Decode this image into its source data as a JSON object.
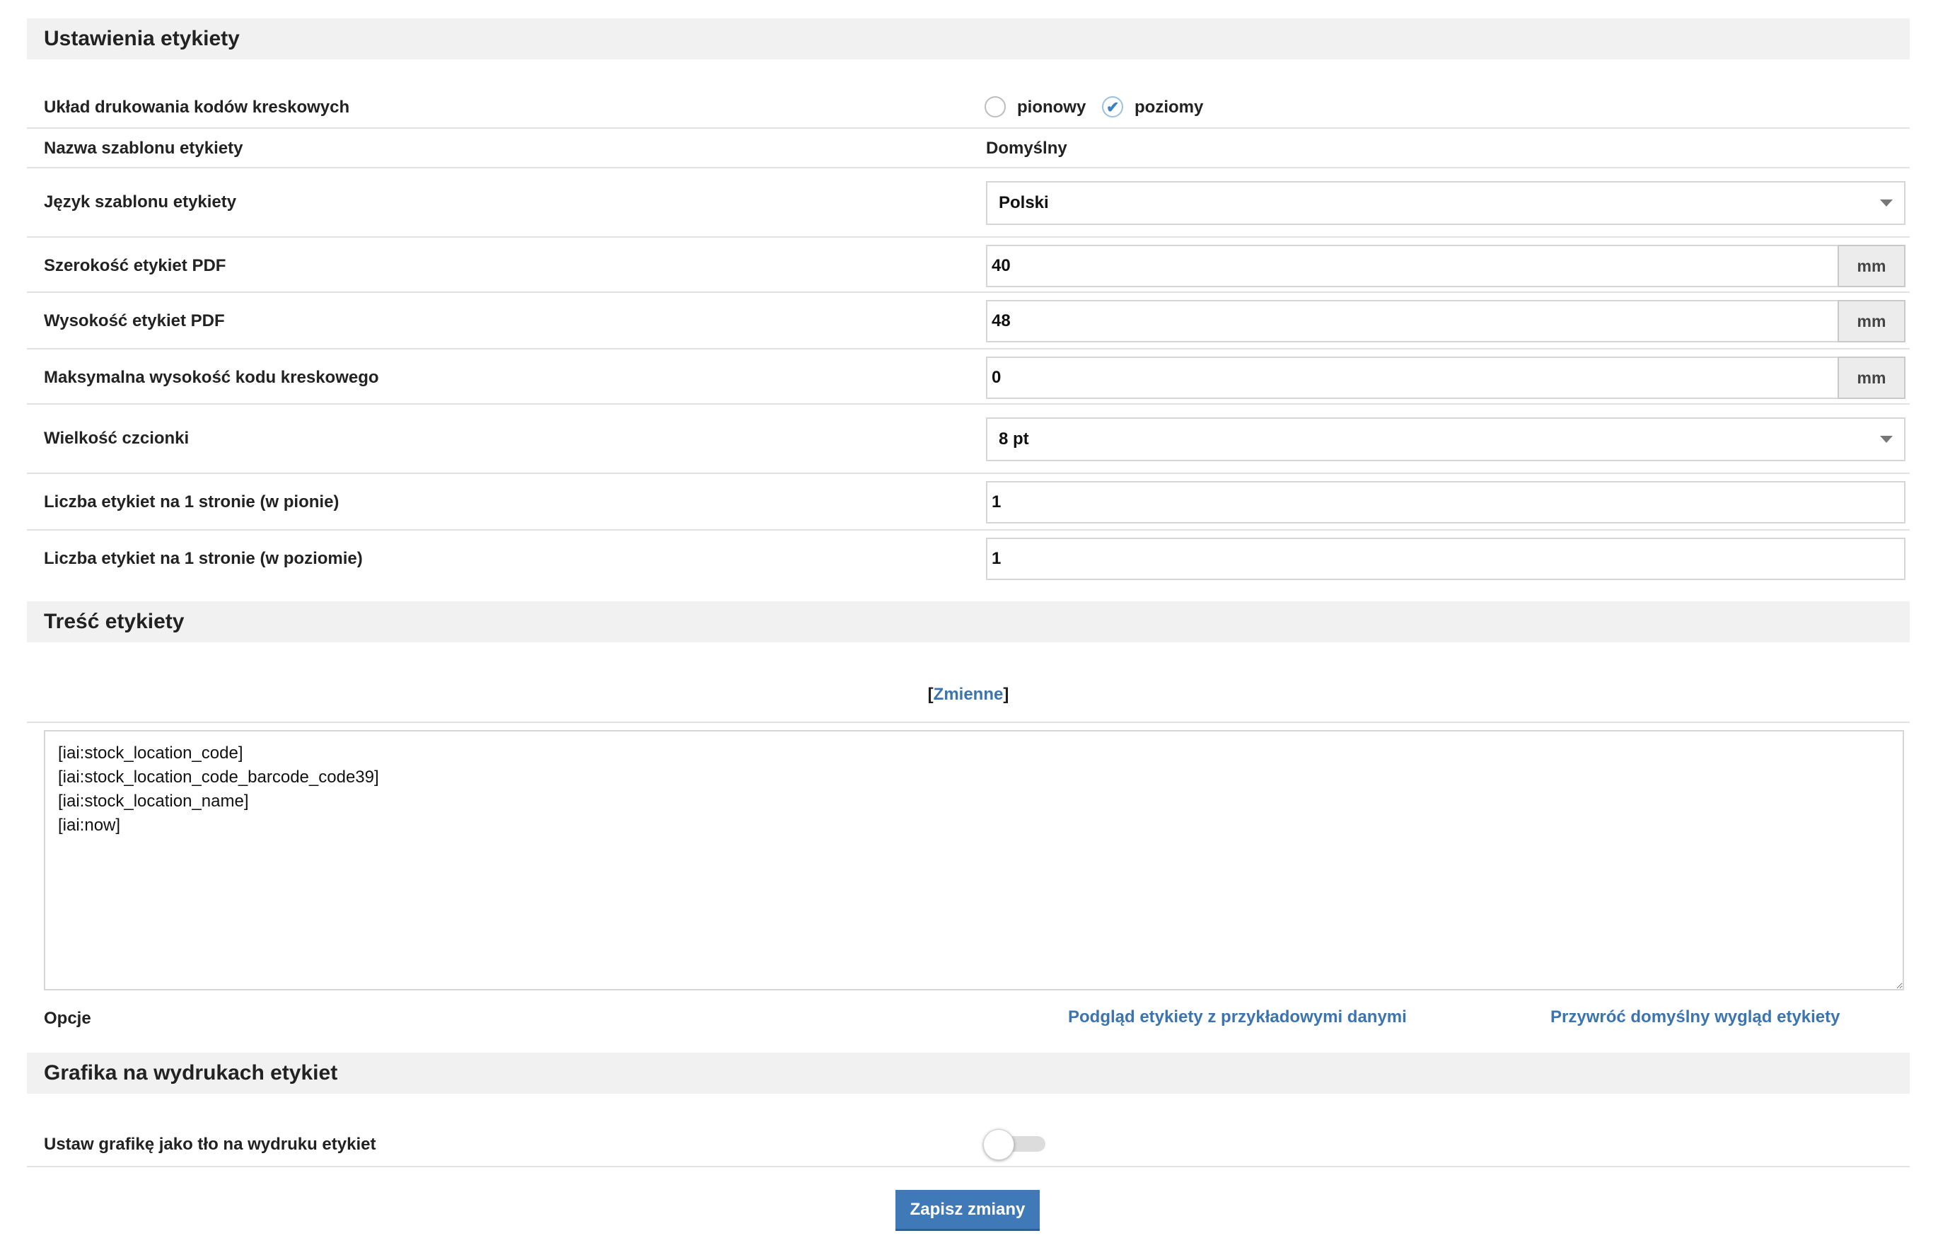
{
  "sections": {
    "label_settings": "Ustawienia etykiety",
    "label_content": "Treść etykiety",
    "graphics": "Grafika na wydrukach etykiet"
  },
  "layout_row": {
    "label": "Układ drukowania kodów kreskowych",
    "options": [
      {
        "label": "pionowy",
        "checked": false
      },
      {
        "label": "poziomy",
        "checked": true
      }
    ]
  },
  "template_name": {
    "label": "Nazwa szablonu etykiety",
    "value": "Domyślny"
  },
  "template_language": {
    "label": "Język szablonu etykiety",
    "value": "Polski"
  },
  "pdf_width": {
    "label": "Szerokość etykiet PDF",
    "value": "40",
    "unit": "mm"
  },
  "pdf_height": {
    "label": "Wysokość etykiet PDF",
    "value": "48",
    "unit": "mm"
  },
  "barcode_max_height": {
    "label": "Maksymalna wysokość kodu kreskowego",
    "value": "0",
    "unit": "mm"
  },
  "font_size": {
    "label": "Wielkość czcionki",
    "value": "8 pt"
  },
  "labels_vertical": {
    "label": "Liczba etykiet na 1 stronie (w pionie)",
    "value": "1"
  },
  "labels_horizontal": {
    "label": "Liczba etykiet na 1 stronie (w poziomie)",
    "value": "1"
  },
  "variables": {
    "open": "[",
    "link": "Zmienne",
    "close": "]"
  },
  "content_text": "[iai:stock_location_code]\n[iai:stock_location_code_barcode_code39]\n[iai:stock_location_name]\n[iai:now]",
  "options_row": {
    "label": "Opcje",
    "preview_link": "Podgląd etykiety z przykładowymi danymi",
    "restore_link": "Przywróć domyślny wygląd etykiety"
  },
  "background_graphic": {
    "label": "Ustaw grafikę jako tło na wydruku etykiet",
    "enabled": false
  },
  "save_button": "Zapisz zmiany",
  "colors": {
    "accent": "#3f79b7",
    "link": "#3c74b0",
    "header_bg": "#f1f1f1"
  }
}
